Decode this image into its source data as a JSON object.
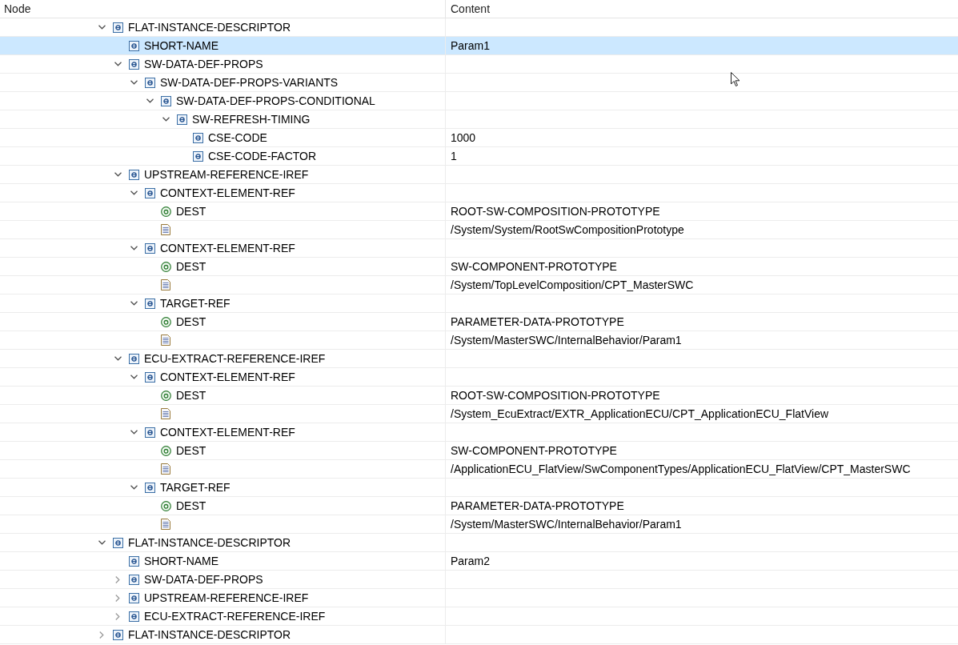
{
  "columns": [
    "Node",
    "Content"
  ],
  "tree": [
    {
      "label": "FLAT-INSTANCE-DESCRIPTOR",
      "kind": "element",
      "expanded": true,
      "selected": false,
      "children": [
        {
          "label": "SHORT-NAME",
          "kind": "element",
          "content": "Param1",
          "selected": true
        },
        {
          "label": "SW-DATA-DEF-PROPS",
          "kind": "element",
          "expanded": true,
          "selected": false,
          "children": [
            {
              "label": "SW-DATA-DEF-PROPS-VARIANTS",
              "kind": "element",
              "expanded": true,
              "selected": false,
              "children": [
                {
                  "label": "SW-DATA-DEF-PROPS-CONDITIONAL",
                  "kind": "element",
                  "expanded": true,
                  "selected": false,
                  "children": [
                    {
                      "label": "SW-REFRESH-TIMING",
                      "kind": "element",
                      "expanded": true,
                      "selected": false,
                      "children": [
                        {
                          "label": "CSE-CODE",
                          "kind": "element",
                          "content": "1000",
                          "selected": false
                        },
                        {
                          "label": "CSE-CODE-FACTOR",
                          "kind": "element",
                          "content": "1",
                          "selected": false
                        }
                      ]
                    }
                  ]
                }
              ]
            }
          ]
        },
        {
          "label": "UPSTREAM-REFERENCE-IREF",
          "kind": "element",
          "expanded": true,
          "selected": false,
          "children": [
            {
              "label": "CONTEXT-ELEMENT-REF",
              "kind": "element",
              "expanded": true,
              "selected": false,
              "children": [
                {
                  "label": "DEST",
                  "kind": "attribute",
                  "content": "ROOT-SW-COMPOSITION-PROTOTYPE",
                  "selected": false
                },
                {
                  "kind": "text",
                  "content": "/System/System/RootSwCompositionPrototype",
                  "selected": false
                }
              ]
            },
            {
              "label": "CONTEXT-ELEMENT-REF",
              "kind": "element",
              "expanded": true,
              "selected": false,
              "children": [
                {
                  "label": "DEST",
                  "kind": "attribute",
                  "content": "SW-COMPONENT-PROTOTYPE",
                  "selected": false
                },
                {
                  "kind": "text",
                  "content": "/System/TopLevelComposition/CPT_MasterSWC",
                  "selected": false
                }
              ]
            },
            {
              "label": "TARGET-REF",
              "kind": "element",
              "expanded": true,
              "selected": false,
              "children": [
                {
                  "label": "DEST",
                  "kind": "attribute",
                  "content": "PARAMETER-DATA-PROTOTYPE",
                  "selected": false
                },
                {
                  "kind": "text",
                  "content": "/System/MasterSWC/InternalBehavior/Param1",
                  "selected": false
                }
              ]
            }
          ]
        },
        {
          "label": "ECU-EXTRACT-REFERENCE-IREF",
          "kind": "element",
          "expanded": true,
          "selected": false,
          "children": [
            {
              "label": "CONTEXT-ELEMENT-REF",
              "kind": "element",
              "expanded": true,
              "selected": false,
              "children": [
                {
                  "label": "DEST",
                  "kind": "attribute",
                  "content": "ROOT-SW-COMPOSITION-PROTOTYPE",
                  "selected": false
                },
                {
                  "kind": "text",
                  "content": "/System_EcuExtract/EXTR_ApplicationECU/CPT_ApplicationECU_FlatView",
                  "selected": false
                }
              ]
            },
            {
              "label": "CONTEXT-ELEMENT-REF",
              "kind": "element",
              "expanded": true,
              "selected": false,
              "children": [
                {
                  "label": "DEST",
                  "kind": "attribute",
                  "content": "SW-COMPONENT-PROTOTYPE",
                  "selected": false
                },
                {
                  "kind": "text",
                  "content": "/ApplicationECU_FlatView/SwComponentTypes/ApplicationECU_FlatView/CPT_MasterSWC",
                  "selected": false
                }
              ]
            },
            {
              "label": "TARGET-REF",
              "kind": "element",
              "expanded": true,
              "selected": false,
              "children": [
                {
                  "label": "DEST",
                  "kind": "attribute",
                  "content": "PARAMETER-DATA-PROTOTYPE",
                  "selected": false
                },
                {
                  "kind": "text",
                  "content": "/System/MasterSWC/InternalBehavior/Param1",
                  "selected": false
                }
              ]
            }
          ]
        }
      ]
    },
    {
      "label": "FLAT-INSTANCE-DESCRIPTOR",
      "kind": "element",
      "expanded": true,
      "selected": false,
      "children": [
        {
          "label": "SHORT-NAME",
          "kind": "element",
          "content": "Param2",
          "selected": false
        },
        {
          "label": "SW-DATA-DEF-PROPS",
          "kind": "element",
          "expanded": false,
          "selected": false
        },
        {
          "label": "UPSTREAM-REFERENCE-IREF",
          "kind": "element",
          "expanded": false,
          "selected": false
        },
        {
          "label": "ECU-EXTRACT-REFERENCE-IREF",
          "kind": "element",
          "expanded": false,
          "selected": false
        }
      ]
    },
    {
      "label": "FLAT-INSTANCE-DESCRIPTOR",
      "kind": "element",
      "expanded": false,
      "selected": false
    }
  ]
}
